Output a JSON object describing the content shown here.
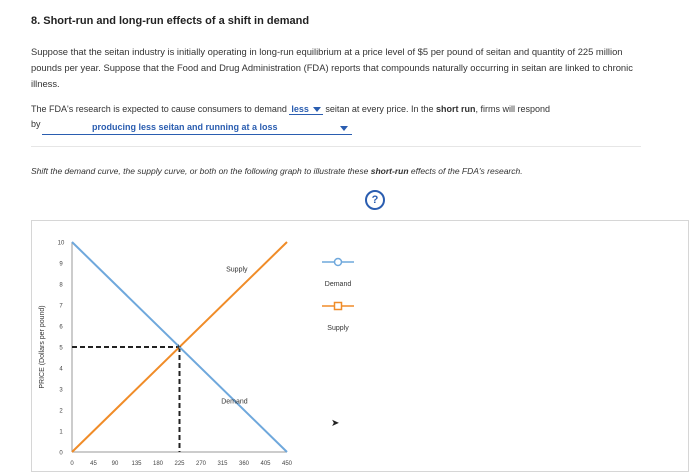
{
  "question": {
    "title": "8. Short-run and long-run effects of a shift in demand",
    "paragraph": "Suppose that the seitan industry is initially operating in long-run equilibrium at a price level of $5 per pound of seitan and quantity of 225 million pounds per year. Suppose that the Food and Drug Administration (FDA) reports that compounds naturally occurring in seitan are linked to chronic illness.",
    "sentence_part1": "The FDA's research is expected to cause consumers to demand",
    "demand_dropdown": "less",
    "sentence_part2": "seitan at every price. In the",
    "short_run": "short run",
    "sentence_part3": ", firms will respond",
    "by_label": "by",
    "firm_response_dropdown": "producing less seitan and running at a loss",
    "instruction_pre": "Shift the demand curve, the supply curve, or both on the following graph to illustrate these",
    "instruction_bold": "short-run",
    "instruction_post": "effects of the FDA's research.",
    "help_symbol": "?"
  },
  "chart_data": {
    "type": "line",
    "ylabel": "PRICE (Dollars per pound)",
    "xlabel": "",
    "xlim": [
      0,
      450
    ],
    "ylim": [
      0,
      10
    ],
    "x_ticks": [
      0,
      45,
      90,
      135,
      180,
      225,
      270,
      315,
      360,
      405,
      450
    ],
    "y_ticks": [
      0,
      1,
      2,
      3,
      4,
      5,
      6,
      7,
      8,
      9,
      10
    ],
    "series": [
      {
        "name": "Supply",
        "color": "#f08c28",
        "points": [
          [
            0,
            0
          ],
          [
            450,
            10
          ]
        ]
      },
      {
        "name": "Demand",
        "color": "#6fa8dc",
        "points": [
          [
            0,
            10
          ],
          [
            450,
            0
          ]
        ]
      }
    ],
    "equilibrium": {
      "x": 225,
      "y": 5
    },
    "legend": [
      {
        "label": "Demand",
        "marker": "circle",
        "color": "#6fa8dc"
      },
      {
        "label": "Supply",
        "marker": "square",
        "color": "#f08c28"
      }
    ],
    "legend_position": "right"
  }
}
